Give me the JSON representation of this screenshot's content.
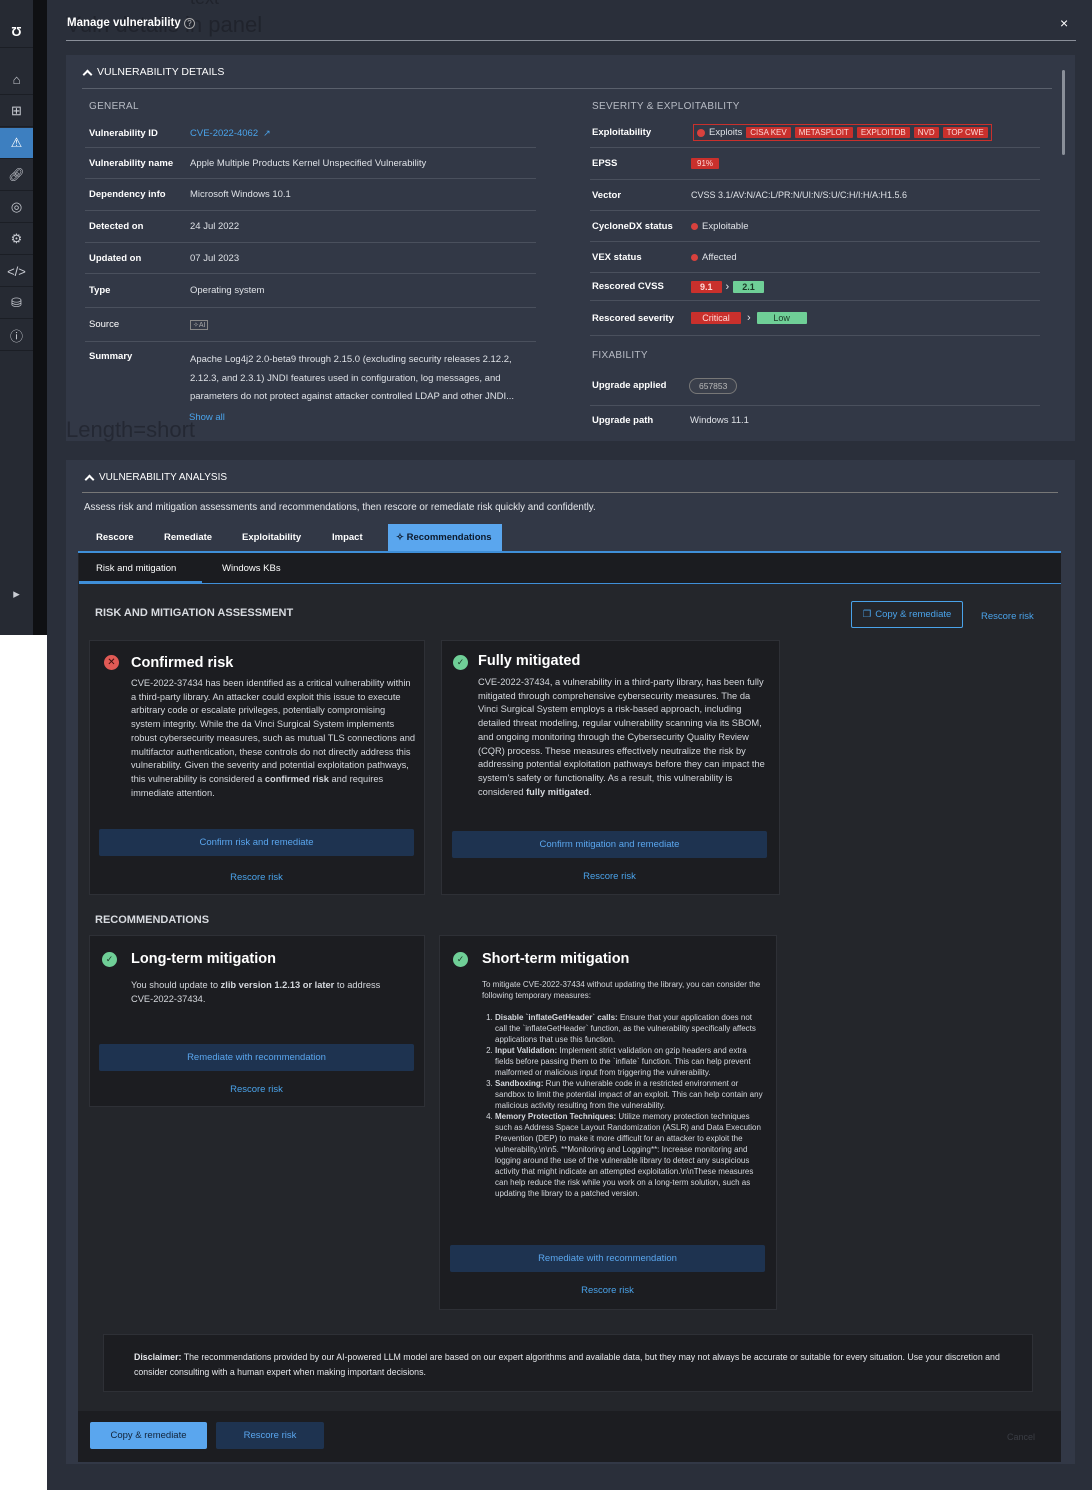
{
  "overlay": {
    "ghost_title": "Vuln details in panel",
    "ghost_top": "text",
    "ghost_length": "Length=short"
  },
  "header": {
    "title": "Manage vulnerability",
    "close": "×"
  },
  "details": {
    "title": "VULNERABILITY DETAILS",
    "general": {
      "heading": "GENERAL",
      "vuln_id_label": "Vulnerability ID",
      "vuln_id": "CVE-2022-4062",
      "name_label": "Vulnerability name",
      "name": "Apple Multiple Products Kernel Unspecified Vulnerability",
      "dep_label": "Dependency info",
      "dep": "Microsoft Windows 10.1",
      "detected_label": "Detected on",
      "detected": "24 Jul 2022",
      "updated_label": "Updated on",
      "updated": "07 Jul 2023",
      "type_label": "Type",
      "type": "Operating system",
      "source_label": "Source",
      "source": "✧AI",
      "summary_label": "Summary",
      "summary": "Apache Log4j2 2.0-beta9 through 2.15.0 (excluding security releases 2.12.2, 2.12.3, and 2.3.1) JNDI features used in configuration, log messages, and parameters do not protect against attacker controlled LDAP and other JNDI...",
      "show_all": "Show all"
    },
    "severity": {
      "heading": "SEVERITY & EXPLOITABILITY",
      "exploit_label": "Exploitability",
      "exploits": "Exploits",
      "exploit_tags": [
        "CISA KEV",
        "METASPLOIT",
        "EXPLOITDB",
        "NVD",
        "TOP CWE"
      ],
      "epss_label": "EPSS",
      "epss": "91%",
      "vector_label": "Vector",
      "vector": "CVSS 3.1/AV:N/AC:L/PR:N/UI:N/S:U/C:H/I:H/A:H1.5.6",
      "cdx_label": "CycloneDX status",
      "cdx": "Exploitable",
      "vex_label": "VEX status",
      "vex": "Affected",
      "cvss_label": "Rescored CVSS",
      "cvss_from": "9.1",
      "cvss_to": "2.1",
      "sev_label": "Rescored severity",
      "sev_from": "Critical",
      "sev_to": "Low"
    },
    "fixability": {
      "heading": "FIXABILITY",
      "upgrade_applied_label": "Upgrade applied",
      "upgrade_applied": "657853",
      "upgrade_path_label": "Upgrade path",
      "upgrade_path": "Windows 11.1"
    }
  },
  "analysis": {
    "title": "VULNERABILITY ANALYSIS",
    "description": "Assess risk and mitigation assessments and recommendations, then rescore or remediate risk quickly and confidently.",
    "tabs": [
      "Rescore",
      "Remediate",
      "Exploitability",
      "Impact",
      "✧ Recommendations"
    ],
    "subtabs": [
      "Risk and mitigation",
      "Windows KBs"
    ],
    "assessment_heading": "RISK AND MITIGATION ASSESSMENT",
    "copy_remediate": "Copy & remediate",
    "rescore_risk": "Rescore risk",
    "confirmed": {
      "title": "Confirmed risk",
      "text": "CVE-2022-37434 has been identified as a critical vulnerability within a third-party library. An attacker could exploit this issue to execute arbitrary code or escalate privileges, potentially compromising system integrity. While the da Vinci Surgical System implements robust cybersecurity measures, such as mutual TLS connections and multifactor authentication, these controls do not directly address this vulnerability. Given the severity and potential exploitation pathways, this vulnerability is considered a ",
      "bold": "confirmed risk",
      "tail": " and requires immediate attention.",
      "button": "Confirm risk and remediate",
      "link": "Rescore risk"
    },
    "mitigated": {
      "title": "Fully mitigated",
      "text": "CVE-2022-37434, a vulnerability in a third-party library, has been fully mitigated through comprehensive cybersecurity measures. The da Vinci Surgical System employs a risk-based approach, including detailed threat modeling, regular vulnerability scanning via its SBOM, and ongoing monitoring through the Cybersecurity Quality Review (CQR) process. These measures effectively neutralize the risk by addressing potential exploitation pathways before they can impact the system's safety or functionality. As a result, this vulnerability is considered ",
      "bold": "fully mitigated",
      "tail": ".",
      "button": "Confirm mitigation and remediate",
      "link": "Rescore risk"
    },
    "recommendations_heading": "RECOMMENDATIONS",
    "long_term": {
      "title": "Long-term mitigation",
      "pre": "You should update to ",
      "bold": "zlib version 1.2.13 or later",
      "post": " to address CVE-2022-37434.",
      "button": "Remediate with recommendation",
      "link": "Rescore risk"
    },
    "short_term": {
      "title": "Short-term mitigation",
      "intro": "To mitigate CVE-2022-37434 without updating the library, you can consider the following temporary measures:",
      "items": [
        {
          "b": "Disable `inflateGetHeader` calls:",
          "t": " Ensure that your application does not call the `inflateGetHeader` function, as the vulnerability specifically affects applications that use this function."
        },
        {
          "b": "Input Validation:",
          "t": " Implement strict validation on gzip headers and extra fields before passing them to the `inflate` function. This can help prevent malformed or malicious input from triggering the vulnerability."
        },
        {
          "b": "Sandboxing:",
          "t": " Run the vulnerable code in a restricted environment or sandbox to limit the potential impact of an exploit. This can help contain any malicious activity resulting from the vulnerability."
        },
        {
          "b": "Memory Protection Techniques:",
          "t": " Utilize memory protection techniques such as Address Space Layout Randomization (ASLR) and Data Execution Prevention (DEP) to make it more difficult for an attacker to exploit the vulnerability.\\n\\n5. **Monitoring and Logging**: Increase monitoring and logging around the use of the vulnerable library to detect any suspicious activity that might indicate an attempted exploitation.\\n\\nThese measures can help reduce the risk while you work on a long-term solution, such as updating the library to a patched version."
        }
      ],
      "button": "Remediate with recommendation",
      "link": "Rescore risk"
    },
    "disclaimer": {
      "bold": "Disclaimer:",
      "text": " The recommendations provided by our AI-powered LLM model are based on our expert algorithms and available data, but they may not always be accurate or suitable for every situation. Use your discretion and consider consulting with a human expert when making important decisions."
    }
  },
  "footer": {
    "copy": "Copy & remediate",
    "rescore": "Rescore risk",
    "cancel": "Cancel"
  }
}
